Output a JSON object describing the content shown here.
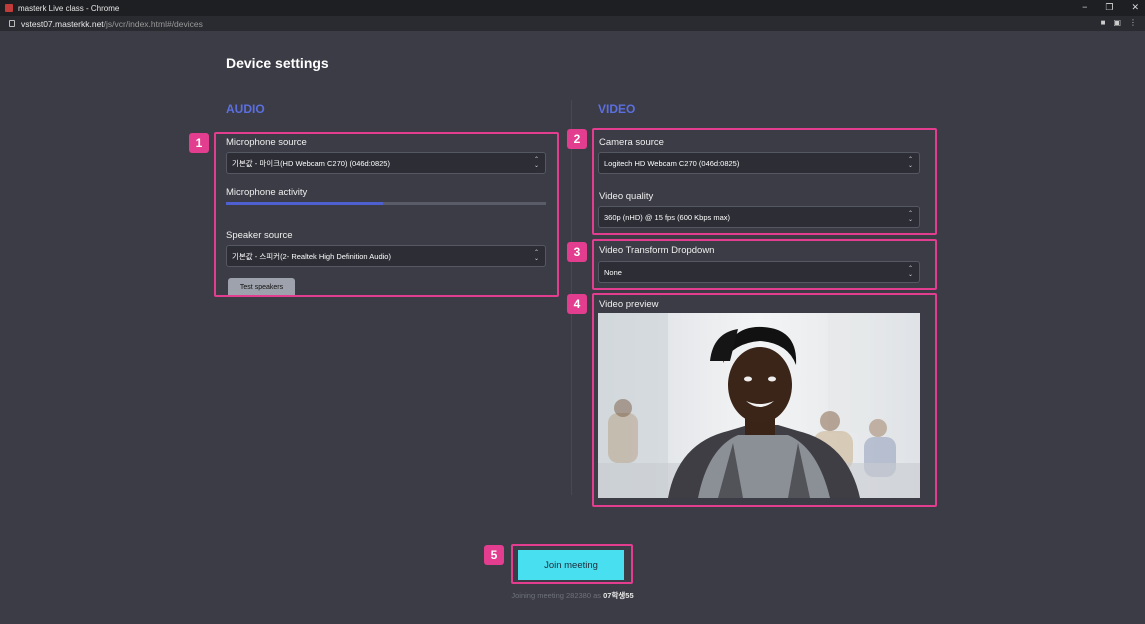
{
  "window": {
    "title": "masterk Live class - Chrome",
    "url_host": "vstest07.masterkk.net",
    "url_path": "/js/vcr/index.html#/devices",
    "controls": {
      "minimize": "−",
      "restore": "❐",
      "close": "✕"
    }
  },
  "page": {
    "title": "Device settings"
  },
  "audio": {
    "heading": "AUDIO",
    "microphone_source_label": "Microphone source",
    "microphone_source_value": "기본값 - 마이크(HD Webcam C270) (046d:0825)",
    "microphone_activity_label": "Microphone activity",
    "microphone_activity_level": 0.49,
    "speaker_source_label": "Speaker source",
    "speaker_source_value": "기본값 - 스피커(2- Realtek High Definition Audio)",
    "test_speakers_label": "Test speakers"
  },
  "video": {
    "heading": "VIDEO",
    "camera_source_label": "Camera source",
    "camera_source_value": "Logitech HD Webcam C270 (046d:0825)",
    "video_quality_label": "Video quality",
    "video_quality_value": "360p (nHD) @ 15 fps (600 Kbps max)",
    "transform_label": "Video Transform Dropdown",
    "transform_value": "None",
    "preview_label": "Video preview"
  },
  "annotations": {
    "n1": "1",
    "n2": "2",
    "n3": "3",
    "n4": "4",
    "n5": "5"
  },
  "footer": {
    "join_label": "Join meeting",
    "joining_prefix": "Joining meeting 282380 as",
    "joining_user": "07학생55"
  },
  "colors": {
    "accent": "#5b6fe0",
    "highlight": "#e23d8e",
    "join": "#48dff0"
  }
}
